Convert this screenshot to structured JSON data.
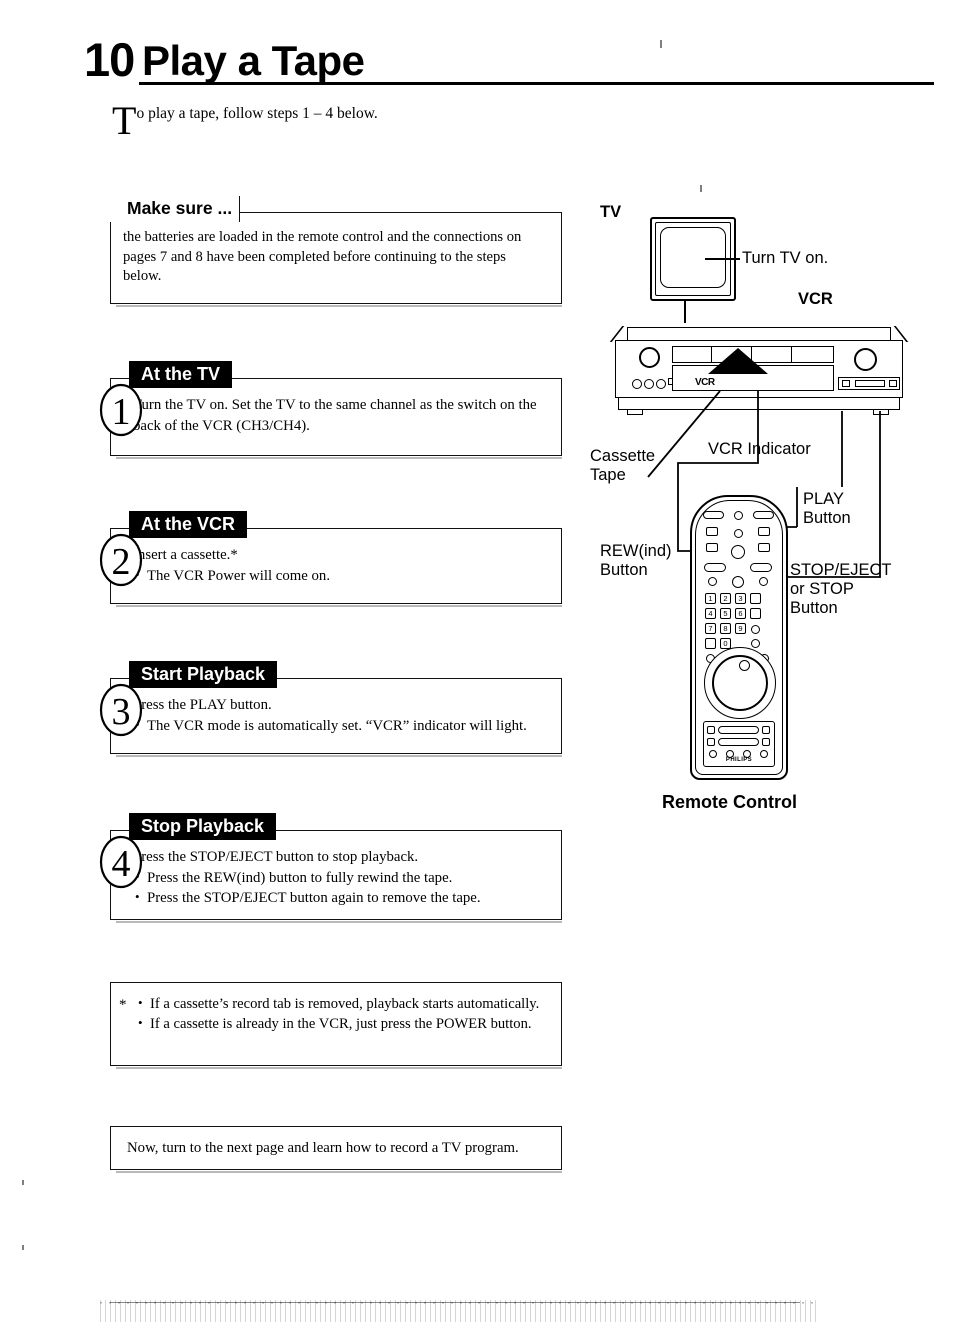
{
  "header": {
    "number": "10",
    "title": "Play a Tape"
  },
  "intro": {
    "dropcap": "T",
    "text": "o play a tape, follow steps 1 – 4 below."
  },
  "make_sure": {
    "tab_label": "Make sure ...",
    "text": "the batteries are loaded in the remote control and the connections on pages 7 and 8 have been completed before continuing to the steps below."
  },
  "steps": [
    {
      "number": "1",
      "tab_label": "At the TV",
      "lead": "Turn the TV on. Set the TV to the same channel as the switch on the back of the VCR (CH3/CH4).",
      "bullets": []
    },
    {
      "number": "2",
      "tab_label": "At the VCR",
      "lead": "Insert a cassette.*",
      "bullets": [
        "The VCR Power will come on."
      ]
    },
    {
      "number": "3",
      "tab_label": "Start Playback",
      "lead": "Press the PLAY button.",
      "bullets": [
        "The VCR mode is automatically set. “VCR” indicator will light."
      ]
    },
    {
      "number": "4",
      "tab_label": "Stop Playback",
      "lead": "Press the STOP/EJECT button to stop playback.",
      "bullets": [
        "Press the REW(ind) button to fully rewind the tape.",
        "Press the STOP/EJECT button again to remove the tape."
      ]
    }
  ],
  "footnote": {
    "marker": "*",
    "bullets": [
      "If a cassette’s record tab is removed, playback starts automatically.",
      "If a cassette is already in the VCR, just press the POWER button."
    ]
  },
  "next_page": {
    "text": "Now, turn to the next page and learn how to record a TV program."
  },
  "illustration": {
    "tv_label": "TV",
    "tv_callout": "Turn TV on.",
    "vcr_label": "VCR",
    "vcr_indicator_display": "VCR",
    "callouts": {
      "cassette_tape": "Cassette\nTape",
      "vcr_indicator": "VCR Indicator",
      "play_button": "PLAY\nButton",
      "rew_button": "REW(ind)\nButton",
      "stop_eject_button": "STOP/EJECT\nor STOP\nButton"
    },
    "remote_caption": "Remote Control",
    "remote_brand": "PHILIPS",
    "keypad": [
      "1",
      "2",
      "3",
      "4",
      "5",
      "6",
      "7",
      "8",
      "9",
      "0"
    ]
  },
  "colors": {
    "ink": "#000000",
    "paper": "#ffffff",
    "tab_fill": "#000000",
    "tab_text": "#ffffff"
  }
}
